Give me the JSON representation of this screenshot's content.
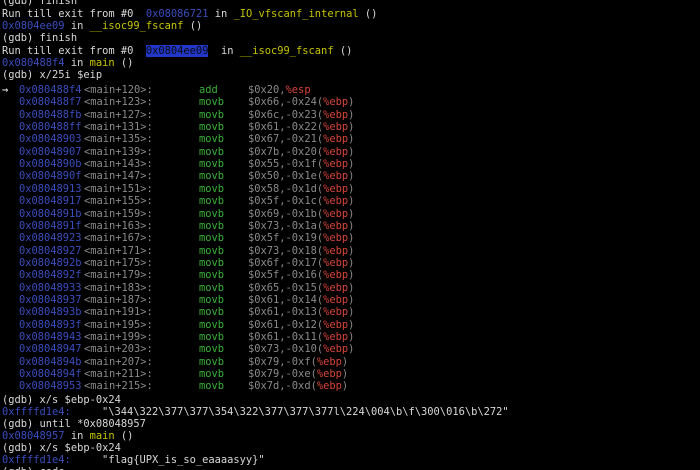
{
  "header": [
    {
      "text": "(gdb) finish"
    },
    {
      "text": "Run till exit from #0  ",
      "addr": "0x08086721",
      "mid": " in ",
      "fn": "_IO_vfscanf_internal",
      "end": " ()"
    },
    {
      "addr": "0x0804ee09",
      "mid": " in ",
      "fn": "__isoc99_fscanf",
      "end": " ()"
    },
    {
      "text": "(gdb) finish"
    },
    {
      "text": "Run till exit from #0  ",
      "addr": "0x0804ee09",
      "mid": "  in ",
      "fn": "__isoc99_fscanf",
      "end": " ()"
    },
    {
      "addr": "0x080488f4",
      "mid": " in ",
      "fn": "main",
      "end": " ()"
    },
    {
      "text": "(gdb) x/25i $eip"
    }
  ],
  "pointer": "⇒",
  "disasm": [
    {
      "addr": "0x080488f4",
      "sym": "<main+120>:",
      "op": "add",
      "src": "$0x20,",
      "dst": "%esp"
    },
    {
      "addr": "0x080488f7",
      "sym": "<main+123>:",
      "op": "movb",
      "src": "$0x66,",
      "off": "-0x24",
      "dst": "%ebp"
    },
    {
      "addr": "0x080488fb",
      "sym": "<main+127>:",
      "op": "movb",
      "src": "$0x6c,",
      "off": "-0x23",
      "dst": "%ebp"
    },
    {
      "addr": "0x080488ff",
      "sym": "<main+131>:",
      "op": "movb",
      "src": "$0x61,",
      "off": "-0x22",
      "dst": "%ebp"
    },
    {
      "addr": "0x08048903",
      "sym": "<main+135>:",
      "op": "movb",
      "src": "$0x67,",
      "off": "-0x21",
      "dst": "%ebp"
    },
    {
      "addr": "0x08048907",
      "sym": "<main+139>:",
      "op": "movb",
      "src": "$0x7b,",
      "off": "-0x20",
      "dst": "%ebp"
    },
    {
      "addr": "0x0804890b",
      "sym": "<main+143>:",
      "op": "movb",
      "src": "$0x55,",
      "off": "-0x1f",
      "dst": "%ebp"
    },
    {
      "addr": "0x0804890f",
      "sym": "<main+147>:",
      "op": "movb",
      "src": "$0x50,",
      "off": "-0x1e",
      "dst": "%ebp"
    },
    {
      "addr": "0x08048913",
      "sym": "<main+151>:",
      "op": "movb",
      "src": "$0x58,",
      "off": "-0x1d",
      "dst": "%ebp"
    },
    {
      "addr": "0x08048917",
      "sym": "<main+155>:",
      "op": "movb",
      "src": "$0x5f,",
      "off": "-0x1c",
      "dst": "%ebp"
    },
    {
      "addr": "0x0804891b",
      "sym": "<main+159>:",
      "op": "movb",
      "src": "$0x69,",
      "off": "-0x1b",
      "dst": "%ebp"
    },
    {
      "addr": "0x0804891f",
      "sym": "<main+163>:",
      "op": "movb",
      "src": "$0x73,",
      "off": "-0x1a",
      "dst": "%ebp"
    },
    {
      "addr": "0x08048923",
      "sym": "<main+167>:",
      "op": "movb",
      "src": "$0x5f,",
      "off": "-0x19",
      "dst": "%ebp"
    },
    {
      "addr": "0x08048927",
      "sym": "<main+171>:",
      "op": "movb",
      "src": "$0x73,",
      "off": "-0x18",
      "dst": "%ebp"
    },
    {
      "addr": "0x0804892b",
      "sym": "<main+175>:",
      "op": "movb",
      "src": "$0x6f,",
      "off": "-0x17",
      "dst": "%ebp"
    },
    {
      "addr": "0x0804892f",
      "sym": "<main+179>:",
      "op": "movb",
      "src": "$0x5f,",
      "off": "-0x16",
      "dst": "%ebp"
    },
    {
      "addr": "0x08048933",
      "sym": "<main+183>:",
      "op": "movb",
      "src": "$0x65,",
      "off": "-0x15",
      "dst": "%ebp"
    },
    {
      "addr": "0x08048937",
      "sym": "<main+187>:",
      "op": "movb",
      "src": "$0x61,",
      "off": "-0x14",
      "dst": "%ebp"
    },
    {
      "addr": "0x0804893b",
      "sym": "<main+191>:",
      "op": "movb",
      "src": "$0x61,",
      "off": "-0x13",
      "dst": "%ebp"
    },
    {
      "addr": "0x0804893f",
      "sym": "<main+195>:",
      "op": "movb",
      "src": "$0x61,",
      "off": "-0x12",
      "dst": "%ebp"
    },
    {
      "addr": "0x08048943",
      "sym": "<main+199>:",
      "op": "movb",
      "src": "$0x61,",
      "off": "-0x11",
      "dst": "%ebp"
    },
    {
      "addr": "0x08048947",
      "sym": "<main+203>:",
      "op": "movb",
      "src": "$0x73,",
      "off": "-0x10",
      "dst": "%ebp"
    },
    {
      "addr": "0x0804894b",
      "sym": "<main+207>:",
      "op": "movb",
      "src": "$0x79,",
      "off": "-0xf",
      "dst": "%ebp"
    },
    {
      "addr": "0x0804894f",
      "sym": "<main+211>:",
      "op": "movb",
      "src": "$0x79,",
      "off": "-0xe",
      "dst": "%ebp"
    },
    {
      "addr": "0x08048953",
      "sym": "<main+215>:",
      "op": "movb",
      "src": "$0x7d,",
      "off": "-0xd",
      "dst": "%ebp"
    }
  ],
  "footer": {
    "cmd1": "(gdb) x/s $ebp-0x24",
    "addr1": "0xffffd1e4:",
    "str1": "\"\\344\\322\\377\\377\\354\\322\\377\\377\\377l\\224\\004\\b\\f\\300\\016\\b\\272\"",
    "cmd2": "(gdb) until *0x08048957",
    "addr2": "0x08048957",
    "in2": " in ",
    "fn2": "main",
    "end2": " ()",
    "cmd3": "(gdb) x/s $ebp-0x24",
    "addr3": "0xffffd1e4:",
    "str3": "\"flag{UPX_is_so_eaaaasyy}\"",
    "cut_prefix": "(gdb) ",
    "cut_cmd": "code"
  }
}
